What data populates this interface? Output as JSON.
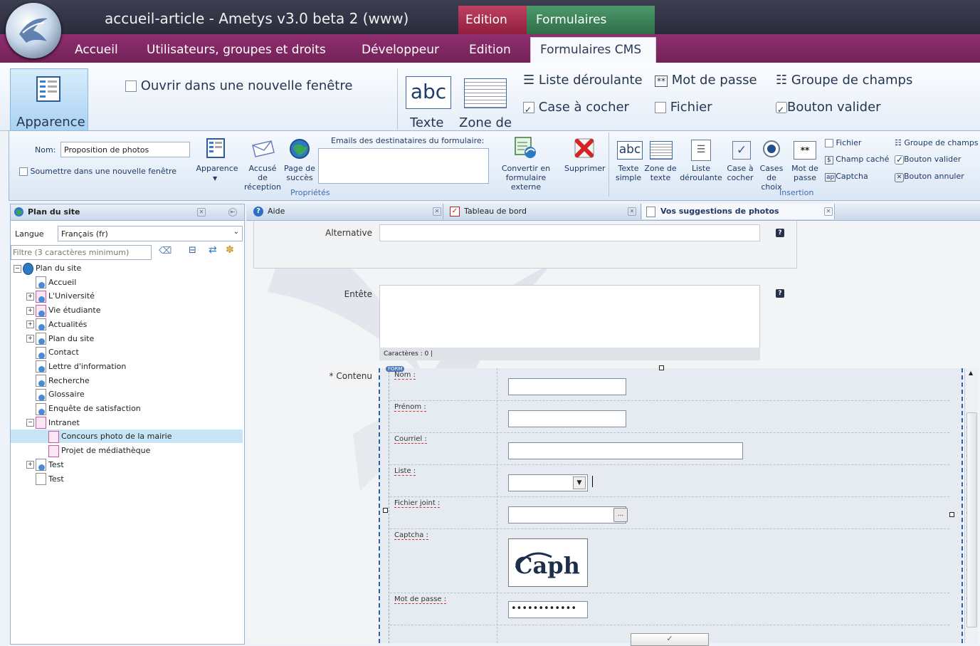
{
  "window": {
    "title": "accueil-article - Ametys v3.0 beta 2 (www)",
    "context_tabs": [
      "Edition",
      "Formulaires"
    ]
  },
  "ribbon_tabs": [
    "Accueil",
    "Utilisateurs, groupes et droits",
    "Développeur",
    "Edition",
    "Formulaires CMS"
  ],
  "big_ribbon": {
    "apparence": "Apparence",
    "open_new_window": "Ouvrir dans une nouvelle fenêtre",
    "texte": "Texte",
    "zone_de": "Zone de",
    "liste_deroulante": "Liste déroulante",
    "mot_de_passe": "Mot de passe",
    "groupe_de_champs": "Groupe de champs",
    "case_a_cocher": "Case à cocher",
    "fichier": "Fichier",
    "bouton_valider": "Bouton valider"
  },
  "ribbon": {
    "nom_label": "Nom:",
    "nom_value": "Proposition de photos",
    "soumettre": "Soumettre dans une nouvelle fenêtre",
    "apparence": "Apparence",
    "accuse_1": "Accusé de",
    "accuse_2": "réception",
    "page_1": "Page de",
    "page_2": "succès",
    "emails_label": "Emails des destinataires du formulaire:",
    "convertir_1": "Convertir en",
    "convertir_2": "formulaire externe",
    "supprimer": "Supprimer",
    "group_proprietes": "Propriétés",
    "texte_simple_1": "Texte",
    "texte_simple_2": "simple",
    "zone_texte_1": "Zone de",
    "zone_texte_2": "texte",
    "liste_1": "Liste",
    "liste_2": "déroulante",
    "case_1": "Case à",
    "case_2": "cocher",
    "cases_1": "Cases",
    "cases_2": "de choix",
    "mdp_1": "Mot de",
    "mdp_2": "passe",
    "fichier": "Fichier",
    "champ_cache": "Champ caché",
    "captcha": "Captcha",
    "groupe_de_champs": "Groupe de champs",
    "bouton_valider": "Bouton valider",
    "bouton_annuler": "Bouton annuler",
    "group_insertion": "Insertion"
  },
  "sitemap": {
    "title": "Plan du site",
    "langue_label": "Langue",
    "langue_value": "Français (fr)",
    "filter_placeholder": "Filtre (3 caractères minimum)",
    "tree": [
      {
        "label": "Plan du site",
        "depth": 0,
        "toggle": "-",
        "icon": "globe"
      },
      {
        "label": "Accueil",
        "depth": 1,
        "toggle": "",
        "icon": "page"
      },
      {
        "label": "L'Université",
        "depth": 1,
        "toggle": "+",
        "icon": "pink"
      },
      {
        "label": "Vie étudiante",
        "depth": 1,
        "toggle": "+",
        "icon": "pink"
      },
      {
        "label": "Actualités",
        "depth": 1,
        "toggle": "+",
        "icon": "page"
      },
      {
        "label": "Plan du site",
        "depth": 1,
        "toggle": "+",
        "icon": "page"
      },
      {
        "label": "Contact",
        "depth": 1,
        "toggle": "",
        "icon": "page"
      },
      {
        "label": "Lettre d'information",
        "depth": 1,
        "toggle": "",
        "icon": "page"
      },
      {
        "label": "Recherche",
        "depth": 1,
        "toggle": "",
        "icon": "page"
      },
      {
        "label": "Glossaire",
        "depth": 1,
        "toggle": "",
        "icon": "page"
      },
      {
        "label": "Enquête de satisfaction",
        "depth": 1,
        "toggle": "",
        "icon": "page"
      },
      {
        "label": "Intranet",
        "depth": 1,
        "toggle": "-",
        "icon": "pinkonly"
      },
      {
        "label": "Concours photo de la mairie",
        "depth": 2,
        "toggle": "",
        "icon": "pinkonly",
        "selected": true
      },
      {
        "label": "Projet de médiathèque",
        "depth": 2,
        "toggle": "",
        "icon": "pinkonly"
      },
      {
        "label": "Test",
        "depth": 1,
        "toggle": "+",
        "icon": "page"
      },
      {
        "label": "Test",
        "depth": 1,
        "toggle": "",
        "icon": "plain"
      }
    ]
  },
  "doc_tabs": [
    "Aide",
    "Tableau de bord",
    "Vos suggestions de photos"
  ],
  "form": {
    "alternative_label": "Alternative",
    "entete_label": "Entête",
    "caracteres": "Caractères : 0",
    "contenu_label": "* Contenu",
    "form_tag": "FORM",
    "fields": [
      "Nom :",
      "Prénom :",
      "Courriel :",
      "Liste :",
      "Fichier joint :",
      "Captcha :",
      "Mot de passe :"
    ],
    "captcha_text": "Caph a",
    "password_mask": "••••••••••••",
    "file_button": "...",
    "help": "?"
  }
}
